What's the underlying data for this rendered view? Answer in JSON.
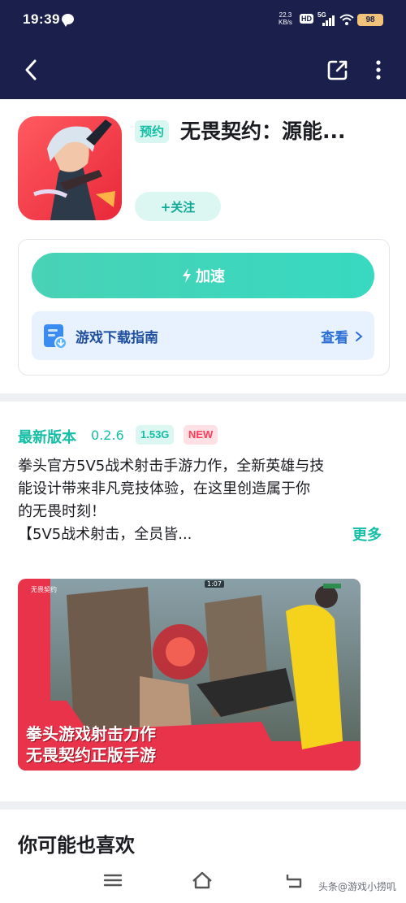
{
  "status_bar": {
    "time": "19:39",
    "net_speed_value": "22.3",
    "net_speed_unit": "KB/s",
    "hd": "HD",
    "network": "5G",
    "battery": "98"
  },
  "header": {
    "back_icon": "chevron-left-icon",
    "share_icon": "share-external-icon",
    "more_icon": "more-vertical-icon"
  },
  "app": {
    "reserve_tag": "预约",
    "title": "无畏契约：源能...",
    "follow_label": "+关注"
  },
  "actions": {
    "speed_label": "加速",
    "guide_label": "游戏下载指南",
    "guide_more": "查看"
  },
  "version": {
    "label": "最新版本",
    "number": "0.2.6",
    "size": "1.53G",
    "badge": "NEW"
  },
  "description": {
    "lines": [
      "拳头官方5V5战术射击手游力作，全新英雄与技",
      "能设计带来非凡竞技体验，在这里创造属于你",
      "的无畏时刻！",
      "【5V5战术射击，全员皆..."
    ],
    "more": "更多"
  },
  "screenshot": {
    "caption_line1": "拳头游戏射击力作",
    "caption_line2": "无畏契约正版手游",
    "logo_text": "无畏契约",
    "timer": "1:07"
  },
  "recommend": {
    "title": "你可能也喜欢"
  },
  "watermark": "头条@游戏小捞叽",
  "colors": {
    "header_bg": "#1a1f4b",
    "accent": "#14bfa6",
    "guide_blue": "#2b6fd6",
    "new_red": "#ff3d5a"
  }
}
